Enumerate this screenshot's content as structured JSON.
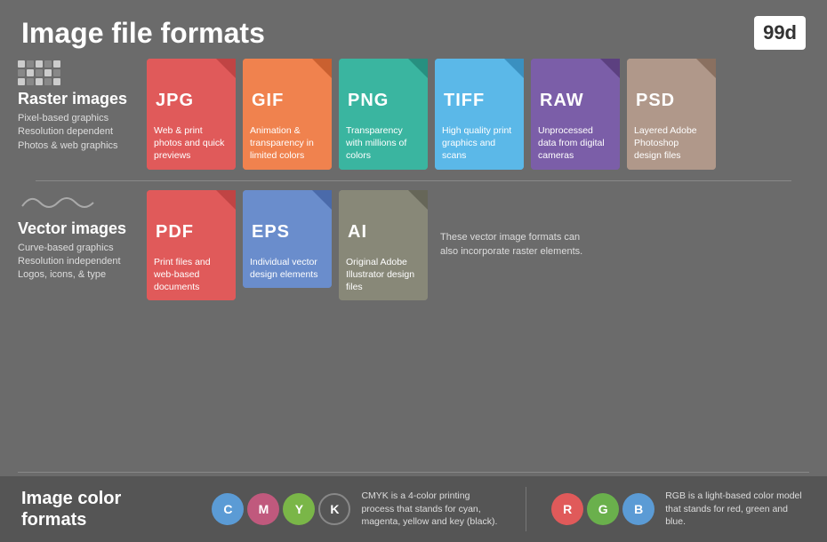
{
  "header": {
    "title": "Image file formats",
    "logo": "99d"
  },
  "raster": {
    "label": "Raster images",
    "description": "Pixel-based graphics\nResolution dependent\nPhotos & web graphics",
    "cards": [
      {
        "id": "jpg",
        "label": "JPG",
        "colorClass": "jpg",
        "description": "Web & print photos and quick previews"
      },
      {
        "id": "gif",
        "label": "GIF",
        "colorClass": "gif",
        "description": "Animation & transparency in limited colors"
      },
      {
        "id": "png",
        "label": "PNG",
        "colorClass": "png",
        "description": "Transparency with millions of colors"
      },
      {
        "id": "tiff",
        "label": "TIFF",
        "colorClass": "tiff",
        "description": "High quality print graphics and scans"
      },
      {
        "id": "raw",
        "label": "RAW",
        "colorClass": "raw",
        "description": "Unprocessed data from digital cameras"
      },
      {
        "id": "psd",
        "label": "PSD",
        "colorClass": "psd",
        "description": "Layered Adobe Photoshop design files"
      }
    ]
  },
  "vector": {
    "label": "Vector images",
    "description": "Curve-based graphics\nResolution independent\nLogos, icons, & type",
    "cards": [
      {
        "id": "pdf",
        "label": "PDF",
        "colorClass": "pdf",
        "description": "Print files and web-based documents"
      },
      {
        "id": "eps",
        "label": "EPS",
        "colorClass": "eps",
        "description": "Individual vector design elements"
      },
      {
        "id": "ai",
        "label": "AI",
        "colorClass": "ai",
        "description": "Original Adobe Illustrator design files"
      }
    ],
    "note": "These vector image formats can also incorporate raster elements."
  },
  "colorFormats": {
    "title": "Image color formats",
    "cmyk": {
      "letters": [
        "C",
        "M",
        "Y",
        "K"
      ],
      "description": "CMYK is a 4-color printing process that stands for cyan, magenta, yellow and key (black)."
    },
    "rgb": {
      "letters": [
        "R",
        "G",
        "B"
      ],
      "description": "RGB is a light-based color model that stands for red, green and blue."
    }
  }
}
